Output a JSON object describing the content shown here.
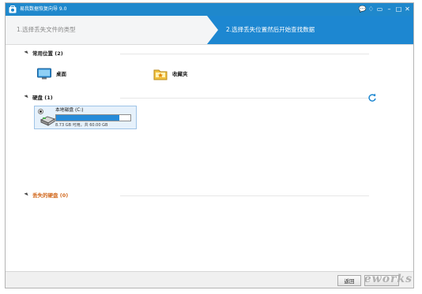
{
  "window": {
    "title": "易我数据恢复向导 9.0",
    "controls": [
      "💬",
      "♢",
      "▭",
      "–",
      "□",
      "✕"
    ]
  },
  "steps": {
    "step1": "1.选择丢失文件的类型",
    "step2": "2.选择丢失位置然后开始查找数据"
  },
  "common": {
    "header": "常用位置 (2)",
    "items": [
      {
        "label": "桌面",
        "icon": "desktop-icon"
      },
      {
        "label": "收藏夹",
        "icon": "favorites-folder-icon"
      }
    ]
  },
  "disks": {
    "header": "硬盘 (1)",
    "items": [
      {
        "label": "本地磁盘 (C:)",
        "capacity": "8.73 GB 可用，共 60.00 GB",
        "used_fraction": 0.855
      }
    ]
  },
  "lost": {
    "header": "丢失的硬盘 (0)"
  },
  "footer": {
    "back_label": "返回"
  },
  "watermark": "eworks",
  "colors": {
    "accent": "#1d87d1",
    "lost_header": "#d2691e"
  }
}
